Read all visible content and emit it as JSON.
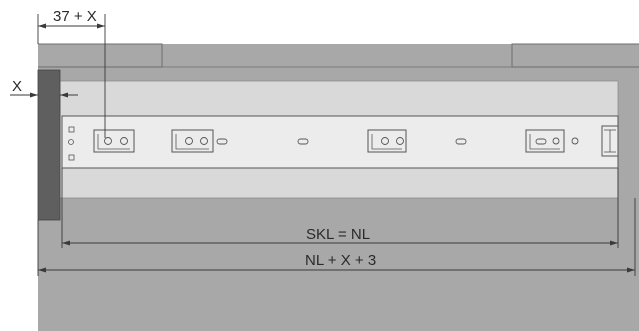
{
  "labels": {
    "offset_top": "37 + X",
    "offset_left": "X",
    "slide_length": "SKL = NL",
    "total_length": "NL + X + 3"
  },
  "colors": {
    "cabinet": "#a8a8a8",
    "cabinet_edge": "#6e6e6e",
    "rail_channel": "#d9d9d9",
    "slide": "#ececec",
    "front_panel": "#5f5f5f",
    "dimension_line": "#3a3a3a",
    "text": "#2a2a2a"
  },
  "icons": [
    "arrow-head-icon",
    "mounting-hole-icon",
    "slot-icon"
  ]
}
